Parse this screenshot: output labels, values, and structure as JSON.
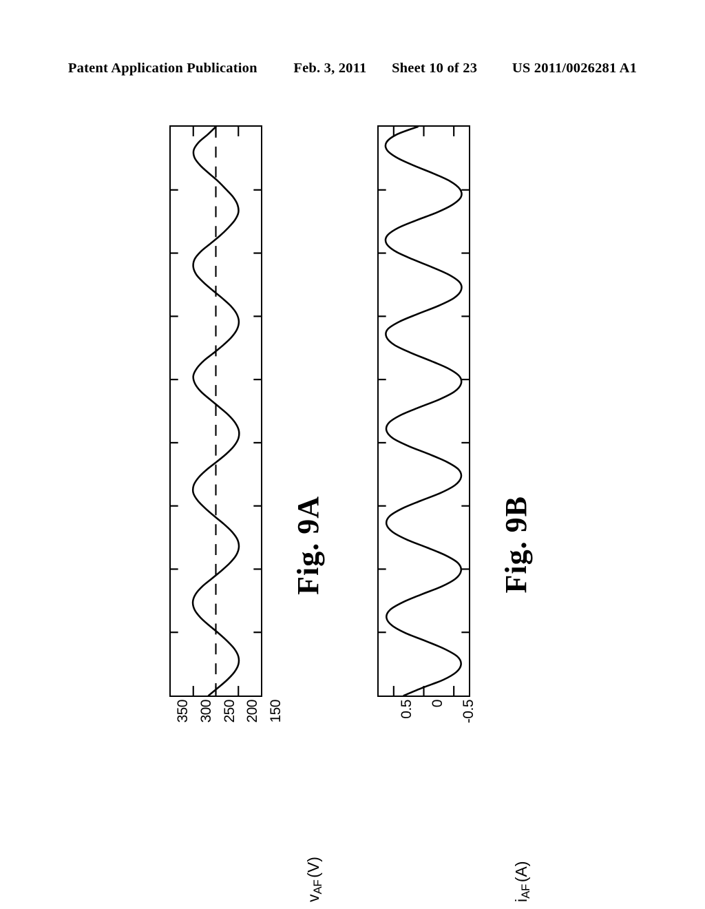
{
  "header": {
    "publication": "Patent Application Publication",
    "date": "Feb. 3, 2011",
    "sheet": "Sheet 10 of 23",
    "doc_number": "US 2011/0026281 A1"
  },
  "figures": [
    {
      "id": "9a",
      "caption": "Fig.  9A",
      "axis_title_main": "v",
      "axis_title_sub": "AF",
      "axis_title_unit": "(V)",
      "tick_labels": [
        "350",
        "300",
        "250",
        "200",
        "150"
      ],
      "chart_data": {
        "type": "line",
        "title": "Fig. 9A",
        "xlabel": "",
        "ylabel": "v_AF (V)",
        "orientation": "rotated-90ccw",
        "grid": false,
        "legend": "none",
        "ylim": [
          150,
          350
        ],
        "yticks": [
          350,
          300,
          250,
          200,
          150
        ],
        "xlim": [
          0,
          9
        ],
        "xticks": [
          0,
          1,
          2,
          3,
          4,
          5,
          6,
          7,
          8,
          9
        ],
        "reference_line": {
          "value": 250,
          "style": "dashed"
        },
        "series": [
          {
            "name": "v_AF",
            "mean": 250,
            "amplitude": 52,
            "cycles": 4.25,
            "values": [
              250,
              268,
              288,
              299,
              297,
              284,
              265,
              245,
              228,
              212,
              202,
              200,
              208,
              223,
              241,
              262,
              283,
              297,
              300,
              293,
              277,
              257,
              236,
              217,
              204,
              199,
              203,
              215,
              233,
              254,
              276,
              292,
              300,
              296,
              283,
              263,
              242,
              222,
              207,
              199,
              200,
              210,
              227,
              248,
              270,
              288,
              299,
              300,
              290,
              273,
              253,
              232,
              214,
              202,
              199,
              205,
              219,
              238,
              259,
              280,
              295,
              301,
              297,
              284,
              265,
              244,
              225,
              209,
              200,
              200,
              209,
              225,
              245,
              266
            ]
          }
        ]
      }
    },
    {
      "id": "9b",
      "caption": "Fig.  9B",
      "axis_title_main": "i",
      "axis_title_sub": "AF",
      "axis_title_unit": "(A)",
      "tick_labels": [
        "0.5",
        "0",
        "-0.5"
      ],
      "chart_data": {
        "type": "line",
        "title": "Fig. 9B",
        "xlabel": "",
        "ylabel": "i_AF (A)",
        "orientation": "rotated-90ccw",
        "grid": false,
        "legend": "none",
        "ylim": [
          -0.75,
          0.75
        ],
        "yticks": [
          0.5,
          0,
          -0.5
        ],
        "xlim": [
          0,
          9
        ],
        "xticks": [
          0,
          1,
          2,
          3,
          4,
          5,
          6,
          7,
          8,
          9
        ],
        "series": [
          {
            "name": "i_AF",
            "mean": 0,
            "amplitude": 0.62,
            "cycles": 4.25,
            "values": [
              0.1,
              0.45,
              0.62,
              0.61,
              0.44,
              0.16,
              -0.16,
              -0.44,
              -0.6,
              -0.62,
              -0.48,
              -0.22,
              0.12,
              0.43,
              0.61,
              0.62,
              0.47,
              0.19,
              -0.13,
              -0.42,
              -0.6,
              -0.62,
              -0.5,
              -0.24,
              0.09,
              0.4,
              0.6,
              0.62,
              0.49,
              0.22,
              -0.1,
              -0.4,
              -0.59,
              -0.62,
              -0.51,
              -0.26,
              0.07,
              0.38,
              0.58,
              0.62,
              0.51,
              0.25,
              -0.08,
              -0.38,
              -0.58,
              -0.62,
              -0.52,
              -0.28,
              0.05,
              0.36,
              0.57,
              0.62,
              0.52,
              0.28,
              -0.05,
              -0.36,
              -0.57,
              -0.62,
              -0.53,
              -0.3,
              0.03,
              0.34,
              0.56,
              0.62,
              0.53,
              0.3,
              -0.03,
              -0.34,
              -0.56,
              -0.62,
              -0.54,
              -0.32,
              0.02,
              0.33
            ]
          }
        ]
      }
    }
  ]
}
